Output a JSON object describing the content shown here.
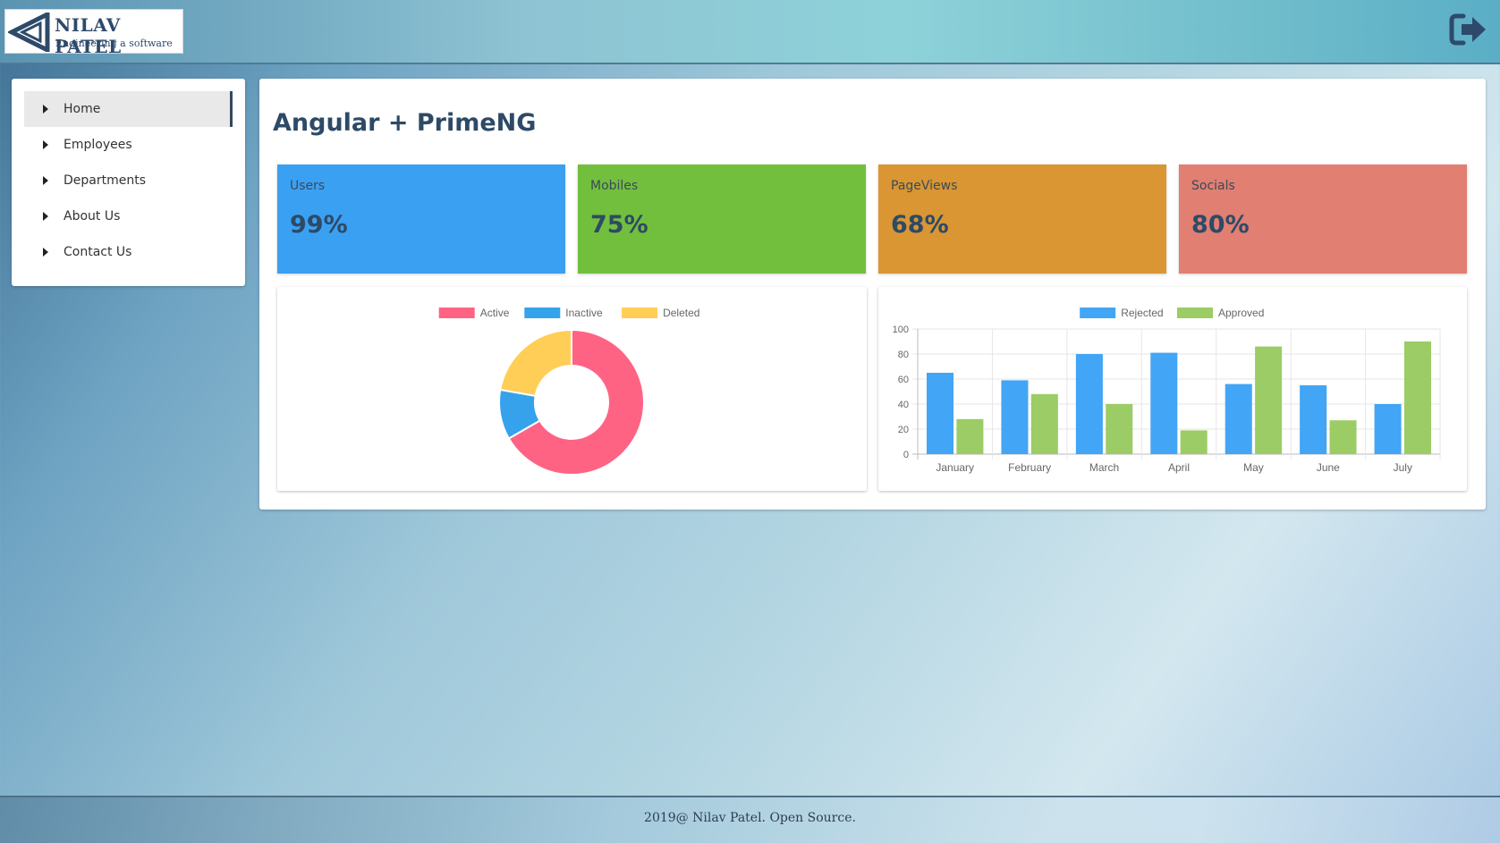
{
  "header": {
    "logo_title": "NILAV PATEL",
    "logo_subtitle": "Engineering a software",
    "logout_icon": "sign-out-icon"
  },
  "sidebar": {
    "items": [
      {
        "label": "Home",
        "active": true
      },
      {
        "label": "Employees",
        "active": false
      },
      {
        "label": "Departments",
        "active": false
      },
      {
        "label": "About Us",
        "active": false
      },
      {
        "label": "Contact Us",
        "active": false
      }
    ]
  },
  "main": {
    "title": "Angular + PrimeNG",
    "cards": [
      {
        "label": "Users",
        "value": "99%",
        "color": "#3aa0f2"
      },
      {
        "label": "Mobiles",
        "value": "75%",
        "color": "#72bf3d"
      },
      {
        "label": "PageViews",
        "value": "68%",
        "color": "#d99633"
      },
      {
        "label": "Socials",
        "value": "80%",
        "color": "#e07f72"
      }
    ]
  },
  "chart_data": [
    {
      "type": "pie",
      "variant": "doughnut",
      "labels": [
        "Active",
        "Inactive",
        "Deleted"
      ],
      "values": [
        300,
        50,
        100
      ],
      "colors": [
        "#ff6384",
        "#36a2eb",
        "#ffce56"
      ],
      "legend": "top"
    },
    {
      "type": "bar",
      "categories": [
        "January",
        "February",
        "March",
        "April",
        "May",
        "June",
        "July"
      ],
      "series": [
        {
          "name": "Rejected",
          "values": [
            65,
            59,
            80,
            81,
            56,
            55,
            40
          ],
          "color": "#42a5f5"
        },
        {
          "name": "Approved",
          "values": [
            28,
            48,
            40,
            19,
            86,
            27,
            90
          ],
          "color": "#9ccc65"
        }
      ],
      "ylim": [
        0,
        100
      ],
      "yticks": [
        0,
        20,
        40,
        60,
        80,
        100
      ],
      "grid": true,
      "legend": "top"
    }
  ],
  "footer": {
    "text": "2019@ Nilav Patel. Open Source."
  }
}
